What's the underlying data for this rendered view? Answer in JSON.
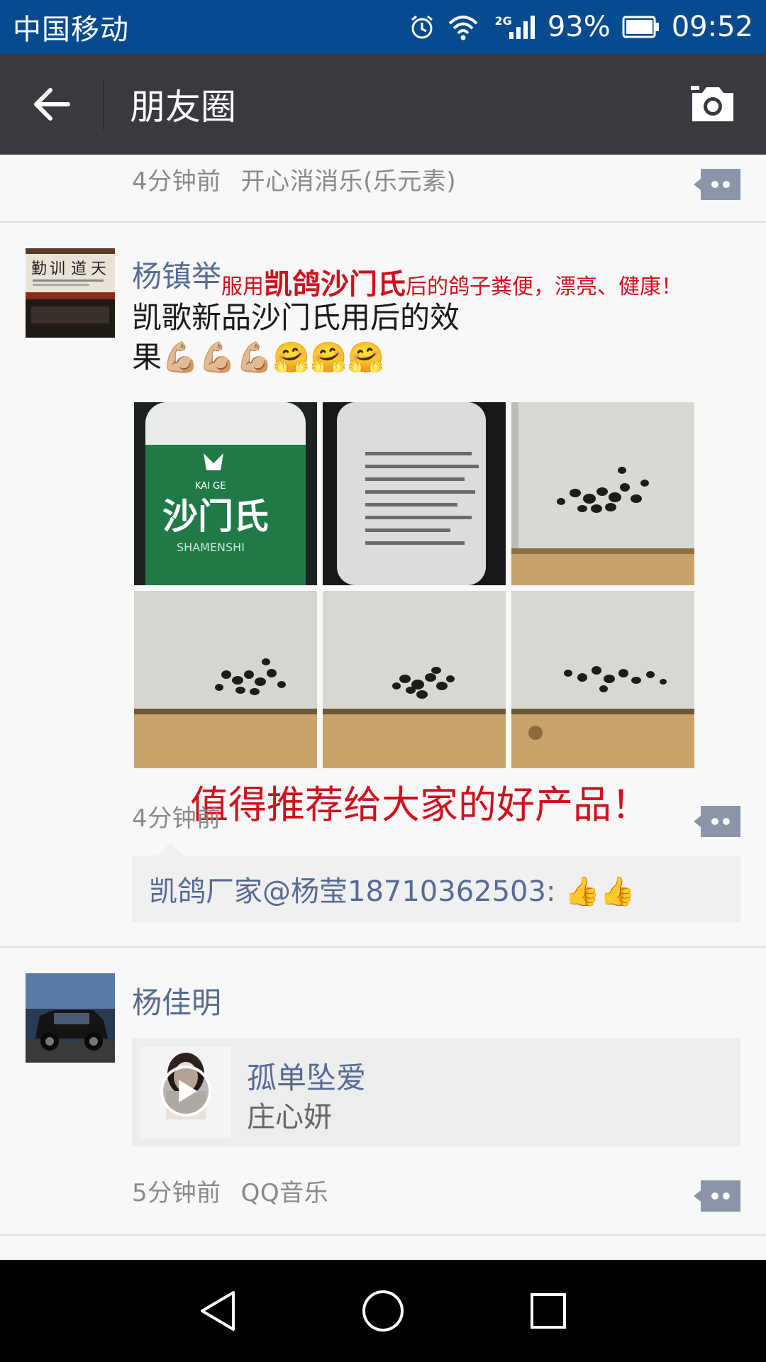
{
  "status_bar": {
    "carrier": "中国移动",
    "network": "2G",
    "battery": "93%",
    "time": "09:52"
  },
  "header": {
    "title": "朋友圈"
  },
  "posts": [
    {
      "time": "4分钟前",
      "source": "开心消消乐(乐元素)"
    },
    {
      "username": "杨镇举",
      "text_line1": "凯歌新品沙门氏用后的效",
      "text_line2": "果💪🏼💪🏼💪🏼🤗🤗🤗",
      "overlay_top_prefix": "服用",
      "overlay_top_brand": "凯鸽沙门氏",
      "overlay_top_suffix": "后的鸽子粪便，漂亮、健康！",
      "overlay_bottom": "值得推荐给大家的好产品！",
      "photo_label_brand": "KAI GE",
      "photo_label_name": "沙门氏",
      "photo_label_pinyin": "SHAMENSHI",
      "time": "4分钟前",
      "comment": "凯鸽厂家@杨莹18710362503: 👍👍"
    },
    {
      "username": "杨佳明",
      "song": "孤单坠爱",
      "artist": "庄心妍",
      "time": "5分钟前",
      "source": "QQ音乐"
    }
  ],
  "colors": {
    "status_bar": "#064a8f",
    "title_bar": "#393a3f",
    "link": "#576b95",
    "overlay_red": "#d0101c"
  }
}
